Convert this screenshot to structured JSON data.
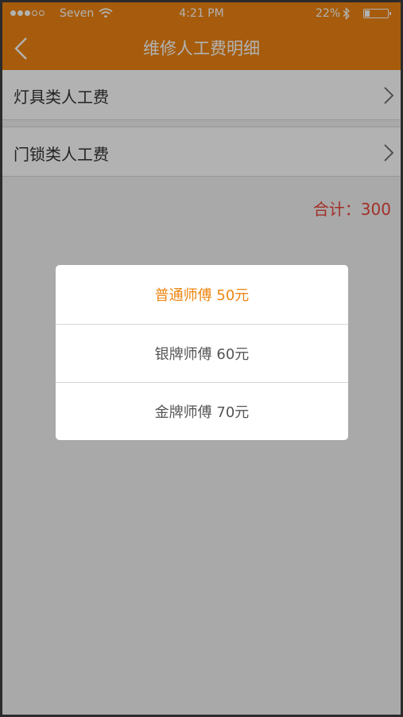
{
  "status_bar": {
    "signal_dots_filled": 3,
    "signal_dots_total": 5,
    "carrier": "Seven",
    "time": "4:21 PM",
    "battery_percent": "22%",
    "battery_level": 0.22
  },
  "nav": {
    "back_icon": "chevron-left-icon",
    "title": "维修人工费明细"
  },
  "list": {
    "items": [
      {
        "label": "灯具类人工费",
        "icon": "chevron-right-icon"
      },
      {
        "label": "门锁类人工费",
        "icon": "chevron-right-icon"
      }
    ]
  },
  "summary": {
    "total": "合计：300"
  },
  "picker": {
    "options": [
      {
        "label": "普通师傅 50元",
        "selected": true
      },
      {
        "label": "银牌师傅 60元",
        "selected": false
      },
      {
        "label": "金牌师傅 70元",
        "selected": false
      }
    ]
  },
  "colors": {
    "header": "#ee8512",
    "accent": "#ee8512",
    "total": "#e8453c"
  }
}
